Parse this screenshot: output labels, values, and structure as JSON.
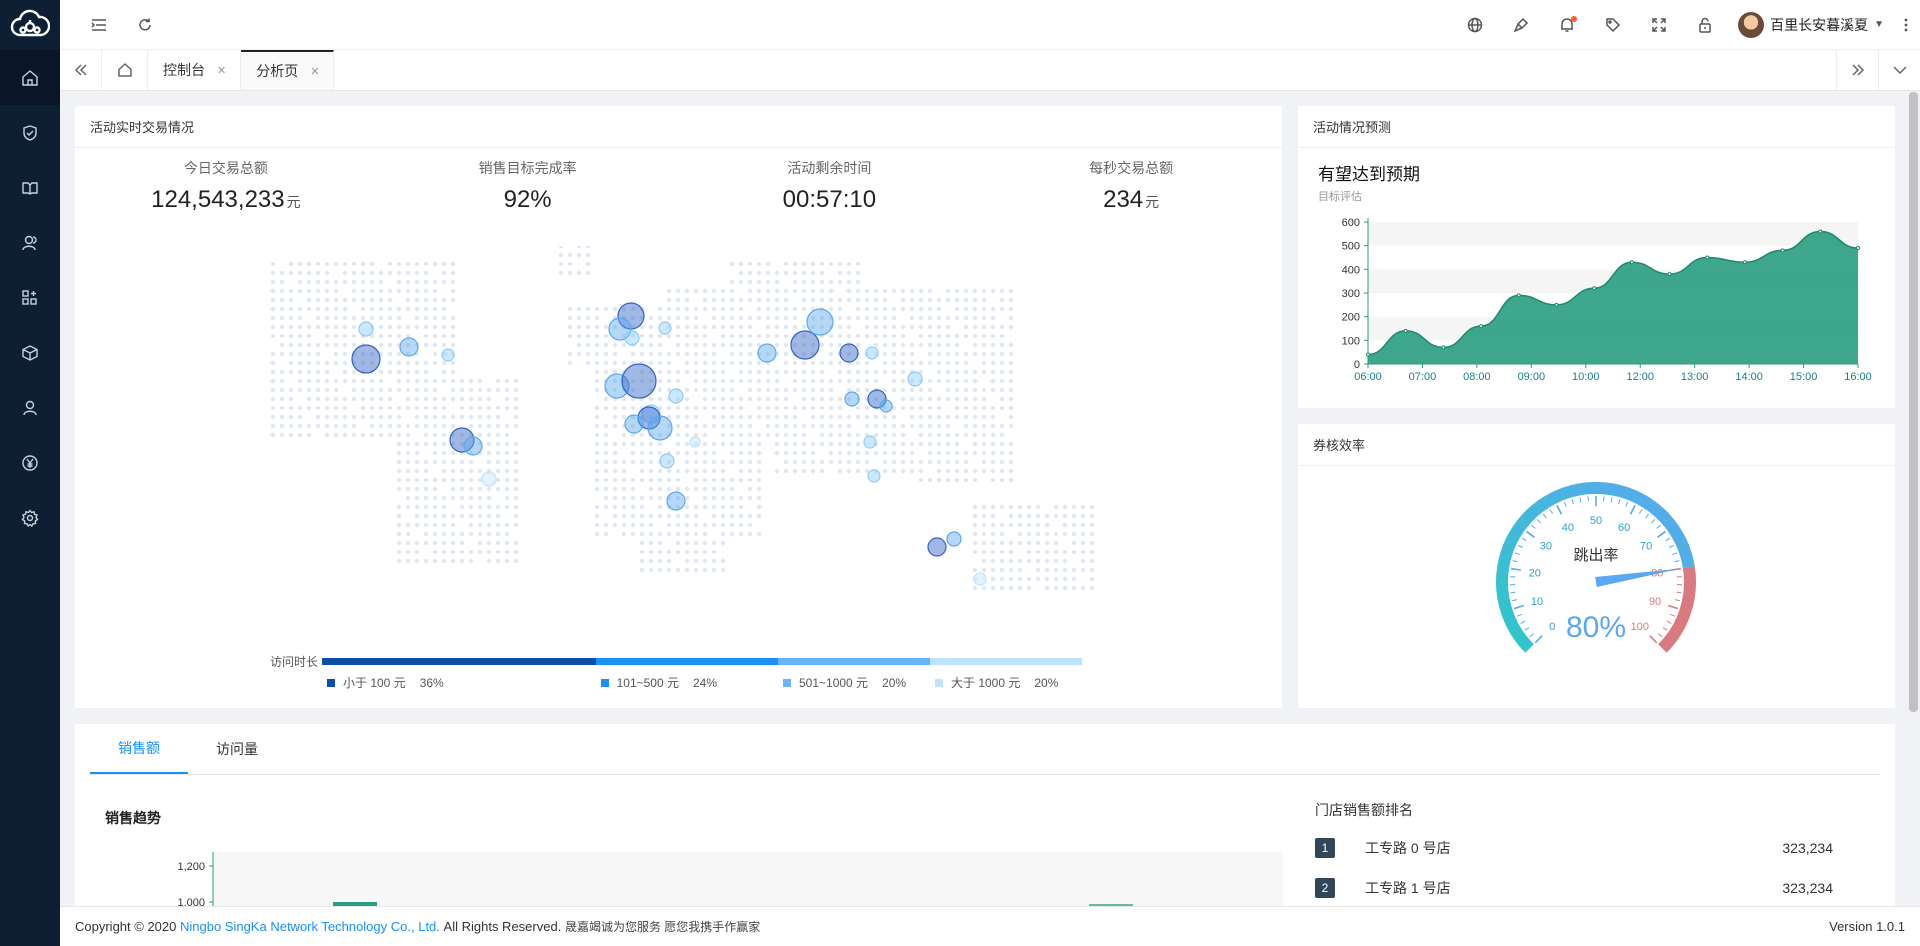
{
  "header": {
    "user_name": "百里长安暮溪夏"
  },
  "tabs": [
    {
      "label": "控制台",
      "active": false
    },
    {
      "label": "分析页",
      "active": true
    }
  ],
  "realtime": {
    "title": "活动实时交易情况",
    "stats": [
      {
        "label": "今日交易总额",
        "value": "124,543,233",
        "unit": "元"
      },
      {
        "label": "销售目标完成率",
        "value": "92%",
        "unit": ""
      },
      {
        "label": "活动剩余时间",
        "value": "00:57:10",
        "unit": ""
      },
      {
        "label": "每秒交易总额",
        "value": "234",
        "unit": "元"
      }
    ],
    "map_legend": {
      "label": "访问时长",
      "items": [
        {
          "label": "小于 100 元",
          "percent": "36%",
          "value": 36,
          "color": "#0d4ea6"
        },
        {
          "label": "101~500 元",
          "percent": "24%",
          "value": 24,
          "color": "#1e90f2"
        },
        {
          "label": "501~1000 元",
          "percent": "20%",
          "value": 20,
          "color": "#66b5fb"
        },
        {
          "label": "大于 1000 元",
          "percent": "20%",
          "value": 20,
          "color": "#bfe3ff"
        }
      ]
    }
  },
  "forecast": {
    "title": "活动情况预测",
    "headline": "有望达到预期",
    "subtitle": "目标评估"
  },
  "efficiency": {
    "title": "券核效率",
    "gauge_label": "跳出率",
    "gauge_value": "80%",
    "gauge_percent": 80,
    "tick_labels": [
      "0",
      "10",
      "20",
      "30",
      "40",
      "50",
      "60",
      "70",
      "80",
      "90",
      "100"
    ]
  },
  "bottom": {
    "tabs": [
      "销售额",
      "访问量"
    ],
    "trend_title": "销售趋势",
    "ranking_title": "门店销售额排名",
    "ranking": [
      {
        "rank": "1",
        "name": "工专路 0 号店",
        "value": "323,234"
      },
      {
        "rank": "2",
        "name": "工专路 1 号店",
        "value": "323,234"
      }
    ]
  },
  "footer": {
    "copyright": "Copyright © 2020",
    "company": "Ningbo SingKa Network Technology Co., Ltd.",
    "rights": "All Rights Reserved.",
    "slogan": "晟嘉竭诚为您服务 愿您我携手作赢家",
    "version": "Version 1.0.1"
  },
  "chart_data": [
    {
      "type": "area",
      "x": [
        "06:00",
        "07:00",
        "08:00",
        "09:00",
        "10:00",
        "12:00",
        "13:00",
        "14:00",
        "15:00",
        "16:00"
      ],
      "series": [
        {
          "values": [
            40,
            140,
            70,
            160,
            290,
            250,
            320,
            430,
            380,
            450,
            430,
            480,
            560,
            490
          ]
        }
      ],
      "ylim": [
        0,
        600
      ],
      "y_ticks": [
        0,
        100,
        200,
        300,
        400,
        500,
        600
      ],
      "grid": true,
      "colors": {
        "fill": "#2a9d82",
        "line": "#1a8a70"
      }
    },
    {
      "type": "bar",
      "title": "销售趋势",
      "y_ticks": [
        "1,200",
        "1,000"
      ],
      "colors": {
        "bar": "#2a9d82"
      }
    }
  ]
}
